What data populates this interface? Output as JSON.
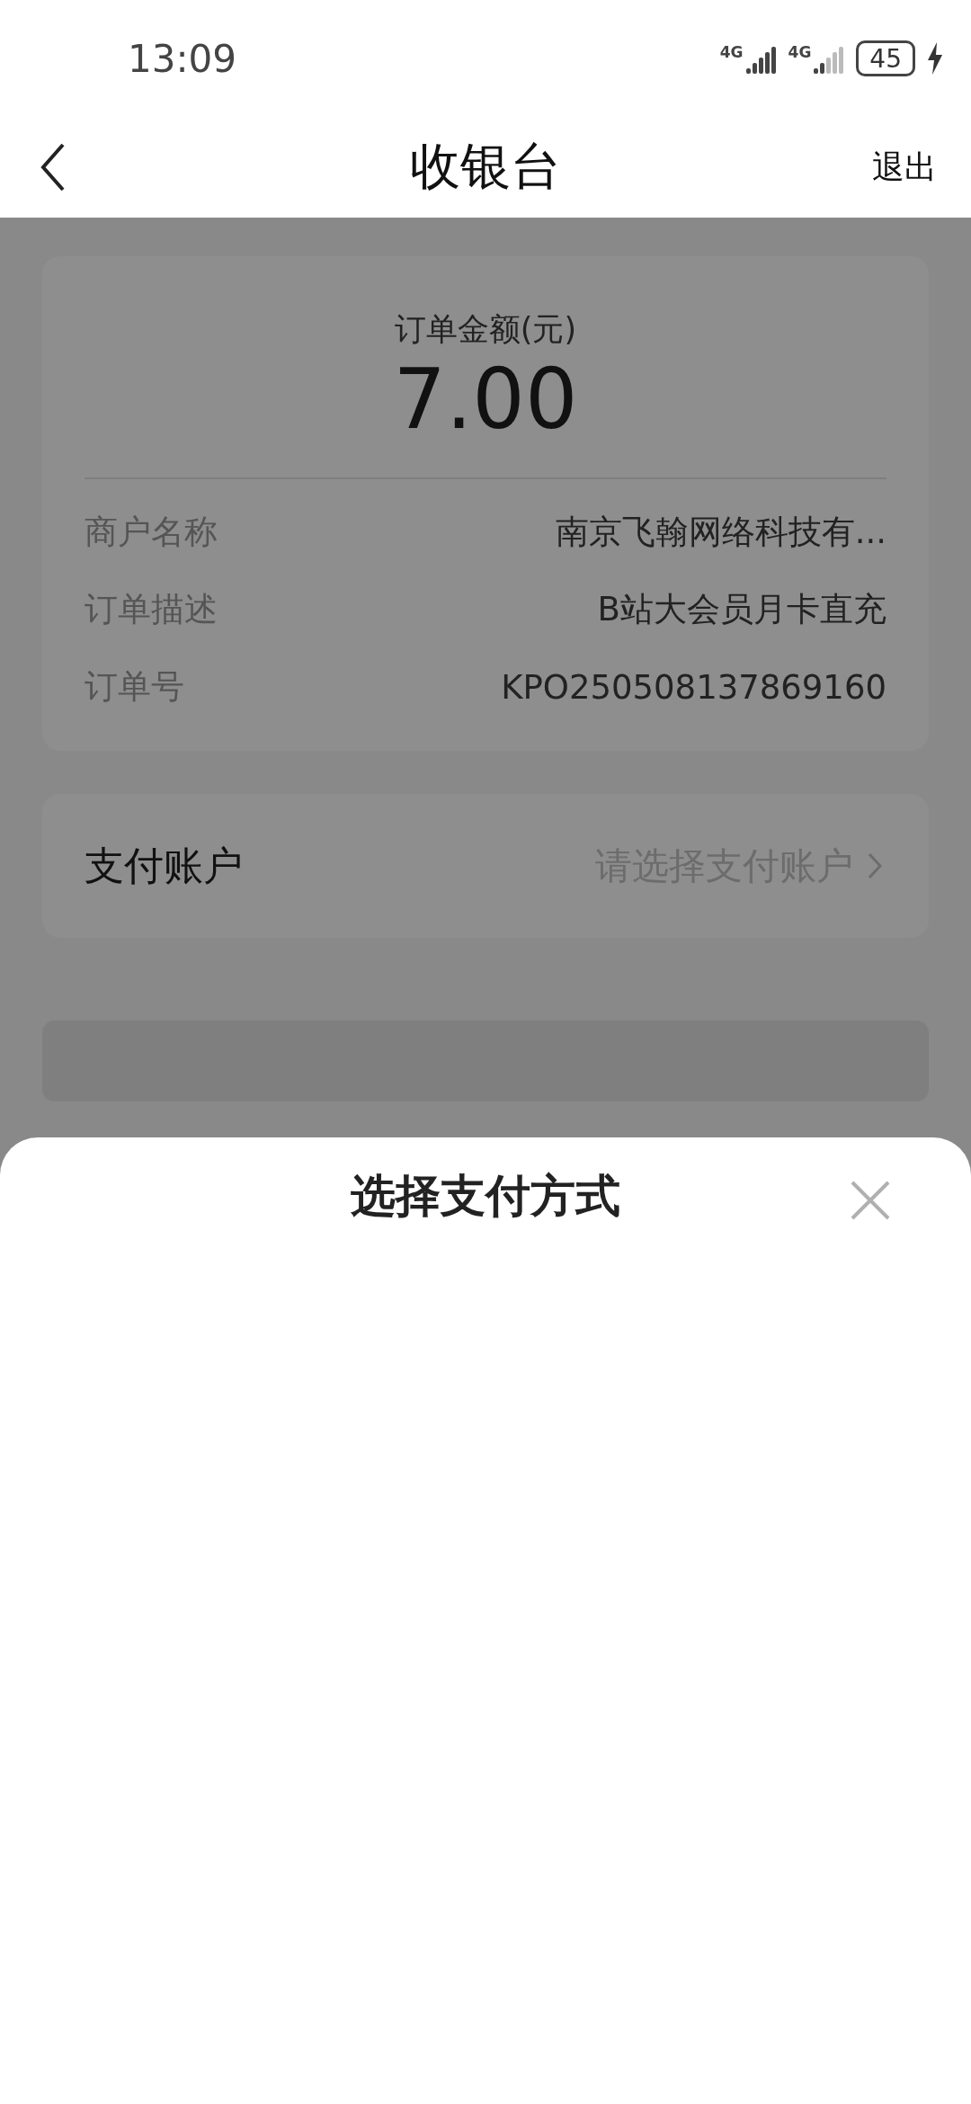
{
  "status_bar": {
    "time": "13:09",
    "networks": [
      "4G",
      "4G"
    ],
    "battery": "45",
    "charging": true
  },
  "header": {
    "title": "收银台",
    "action": "退出"
  },
  "order": {
    "amount_label": "订单金额(元)",
    "amount": "7.00",
    "details": [
      {
        "label": "商户名称",
        "value": "南京飞翰网络科技有..."
      },
      {
        "label": "订单描述",
        "value": "B站大会员月卡直充"
      },
      {
        "label": "订单号",
        "value": "KPO250508137869160"
      }
    ]
  },
  "account": {
    "label": "支付账户",
    "placeholder": "请选择支付账户"
  },
  "sheet": {
    "title": "选择支付方式"
  }
}
